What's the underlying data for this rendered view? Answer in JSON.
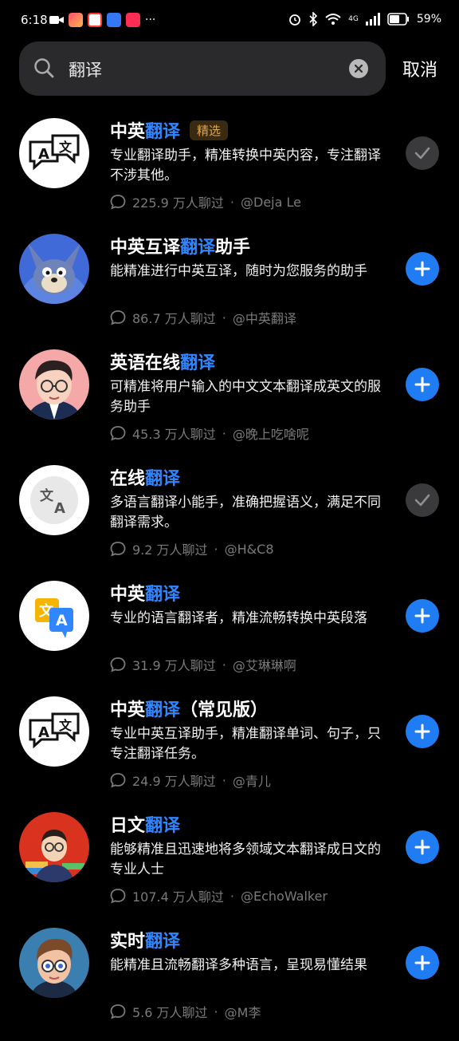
{
  "status_bar": {
    "time": "6:18",
    "network": "4G",
    "battery": "59%"
  },
  "search": {
    "query": "翻译",
    "cancel_label": "取消"
  },
  "badge_featured": "精选",
  "results": [
    {
      "title_pre": "中英",
      "title_hl": "翻译",
      "title_post": "",
      "badge": true,
      "desc": "专业翻译助手，精准转换中英内容，专注翻译不涉其他。",
      "chats": "225.9 万人聊过",
      "author": "@Deja Le",
      "state": "added",
      "avatar_icon": "translate-bubble-icon"
    },
    {
      "title_pre": "中英互译",
      "title_hl": "翻译",
      "title_post": "助手",
      "badge": false,
      "desc": "能精准进行中英互译，随时为您服务的助手",
      "chats": "86.7 万人聊过",
      "author": "@中英翻译",
      "state": "add",
      "avatar_icon": "cartoon-cat-avatar"
    },
    {
      "title_pre": "英语在线",
      "title_hl": "翻译",
      "title_post": "",
      "badge": false,
      "desc": "可精准将用户输入的中文文本翻译成英文的服务助手",
      "chats": "45.3 万人聊过",
      "author": "@晚上吃啥呢",
      "state": "add",
      "avatar_icon": "boy-glasses-avatar"
    },
    {
      "title_pre": "在线",
      "title_hl": "翻译",
      "title_post": "",
      "badge": false,
      "desc": "多语言翻译小能手，准确把握语义，满足不同翻译需求。",
      "chats": "9.2 万人聊过",
      "author": "@H&C8",
      "state": "added",
      "avatar_icon": "translate-circle-icon"
    },
    {
      "title_pre": "中英",
      "title_hl": "翻译",
      "title_post": "",
      "badge": false,
      "desc": "专业的语言翻译者，精准流畅转换中英段落",
      "chats": "31.9 万人聊过",
      "author": "@艾琳琳啊",
      "state": "add",
      "avatar_icon": "translate-color-icon"
    },
    {
      "title_pre": "中英",
      "title_hl": "翻译",
      "title_post": "（常见版）",
      "badge": false,
      "desc": "专业中英互译助手，精准翻译单词、句子，只专注翻译任务。",
      "chats": "24.9 万人聊过",
      "author": "@青儿",
      "state": "add",
      "avatar_icon": "translate-bubble-icon"
    },
    {
      "title_pre": "日文",
      "title_hl": "翻译",
      "title_post": "",
      "badge": false,
      "desc": "能够精准且迅速地将多领域文本翻译成日文的专业人士",
      "chats": "107.4 万人聊过",
      "author": "@EchoWalker",
      "state": "add",
      "avatar_icon": "man-books-avatar"
    },
    {
      "title_pre": "实时",
      "title_hl": "翻译",
      "title_post": "",
      "badge": false,
      "desc": "能精准且流畅翻译多种语言，呈现易懂结果",
      "chats": "5.6 万人聊过",
      "author": "@M李",
      "state": "add",
      "avatar_icon": "boy-3d-avatar"
    }
  ]
}
